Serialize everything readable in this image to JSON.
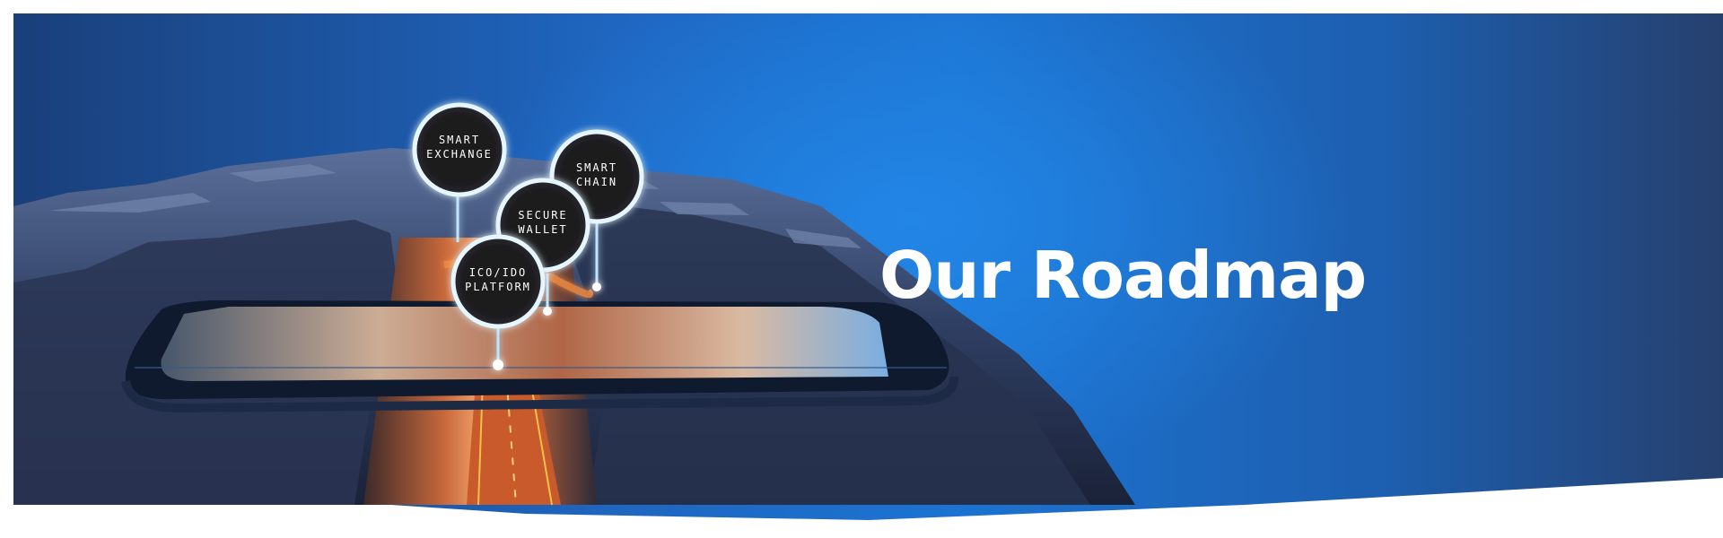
{
  "hero": {
    "title": "Our Roadmap"
  },
  "pins": [
    {
      "name": "smart-exchange",
      "line1": "SMART",
      "line2": "EXCHANGE"
    },
    {
      "name": "smart-chain",
      "line1": "SMART",
      "line2": "CHAIN"
    },
    {
      "name": "secure-wallet",
      "line1": "SECURE",
      "line2": "WALLET"
    },
    {
      "name": "ico-ido-platform",
      "line1": "ICO/IDO",
      "line2": "PLATFORM"
    }
  ],
  "colors": {
    "accent_blue": "#1f78d8",
    "road_orange": "#e0733a",
    "glow": "#bfe4ff"
  }
}
